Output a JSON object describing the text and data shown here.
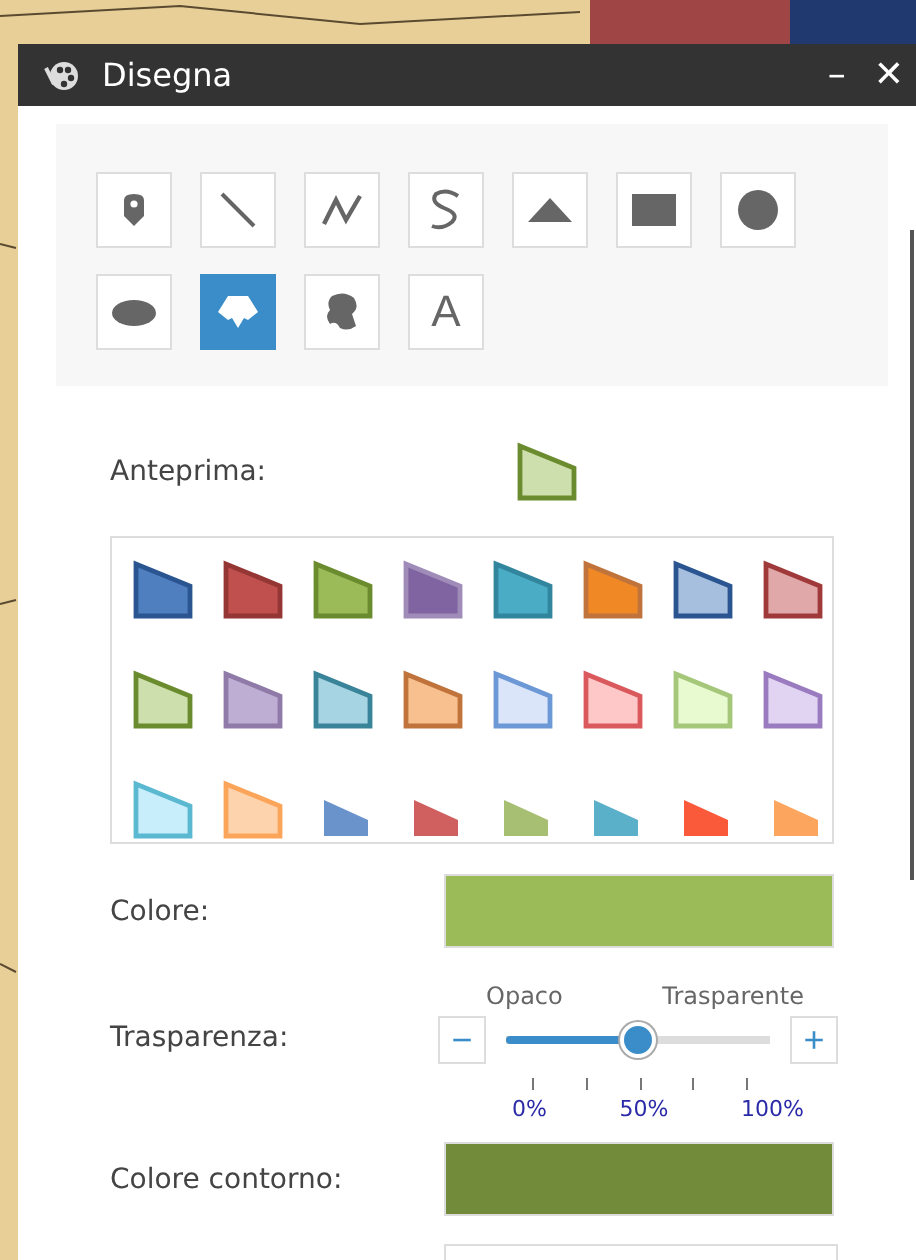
{
  "window": {
    "title": "Disegna",
    "minimize": "–",
    "close": "✕"
  },
  "tools": [
    {
      "kind": "point",
      "selected": false
    },
    {
      "kind": "line",
      "selected": false
    },
    {
      "kind": "polyline",
      "selected": false
    },
    {
      "kind": "freehand-line",
      "selected": false
    },
    {
      "kind": "triangle",
      "selected": false
    },
    {
      "kind": "rectangle",
      "selected": false
    },
    {
      "kind": "circle",
      "selected": false
    },
    {
      "kind": "ellipse",
      "selected": false
    },
    {
      "kind": "polygon",
      "selected": true
    },
    {
      "kind": "freehand-polygon",
      "selected": false
    },
    {
      "kind": "text",
      "label": "A",
      "selected": false
    }
  ],
  "preview": {
    "label": "Anteprima:",
    "fill": {
      "color": "#cddfac"
    },
    "outline": {
      "color": "#6b8c2e"
    }
  },
  "swatches": [
    {
      "kind": "outlined",
      "fill": {
        "color": "#4f7fbf"
      },
      "outline": {
        "color": "#2a5590"
      }
    },
    {
      "kind": "outlined",
      "fill": {
        "color": "#c0504d"
      },
      "outline": {
        "color": "#943634"
      }
    },
    {
      "kind": "outlined",
      "fill": {
        "color": "#9bbb59"
      },
      "outline": {
        "color": "#6b8c2e"
      }
    },
    {
      "kind": "outlined",
      "fill": {
        "color": "#8064a2"
      },
      "outline": {
        "color": "#9f8cb8"
      }
    },
    {
      "kind": "outlined",
      "fill": {
        "color": "#4bacc6"
      },
      "outline": {
        "color": "#31859c"
      }
    },
    {
      "kind": "outlined",
      "fill": {
        "color": "#f08826"
      },
      "outline": {
        "color": "#c0743c"
      }
    },
    {
      "kind": "outlined",
      "fill": {
        "color": "#a7bfde"
      },
      "outline": {
        "color": "#2a5590"
      }
    },
    {
      "kind": "outlined",
      "fill": {
        "color": "#e0a8a8"
      },
      "outline": {
        "color": "#a0393a"
      }
    },
    {
      "kind": "outlined",
      "fill": {
        "color": "#cddfac"
      },
      "outline": {
        "color": "#6b8c2e"
      }
    },
    {
      "kind": "outlined",
      "fill": {
        "color": "#beaed4"
      },
      "outline": {
        "color": "#8f7aa8"
      }
    },
    {
      "kind": "outlined",
      "fill": {
        "color": "#a6d4e2"
      },
      "outline": {
        "color": "#3a8499"
      }
    },
    {
      "kind": "outlined",
      "fill": {
        "color": "#f7c08e"
      },
      "outline": {
        "color": "#c0743c"
      }
    },
    {
      "kind": "outlined",
      "fill": {
        "color": "#dbe5fa"
      },
      "outline": {
        "color": "#6c98d6"
      }
    },
    {
      "kind": "outlined",
      "fill": {
        "color": "#ffc8c8"
      },
      "outline": {
        "color": "#d9595c"
      }
    },
    {
      "kind": "outlined",
      "fill": {
        "color": "#e8fbd0"
      },
      "outline": {
        "color": "#a5c77a"
      }
    },
    {
      "kind": "outlined",
      "fill": {
        "color": "#e0d4f2"
      },
      "outline": {
        "color": "#9b7bc0"
      }
    },
    {
      "kind": "outlined",
      "fill": {
        "color": "#c8eefc"
      },
      "outline": {
        "color": "#5ab8d0"
      }
    },
    {
      "kind": "outlined",
      "fill": {
        "color": "#fdd3ae"
      },
      "outline": {
        "color": "#fba55a"
      }
    },
    {
      "kind": "plain",
      "fill": {
        "color": "#6a93cb"
      }
    },
    {
      "kind": "plain",
      "fill": {
        "color": "#d06060"
      }
    },
    {
      "kind": "plain",
      "fill": {
        "color": "#a6bf72"
      }
    },
    {
      "kind": "plain",
      "fill": {
        "color": "#5ab0c8"
      }
    },
    {
      "kind": "plain",
      "fill": {
        "color": "#fb5a3a"
      }
    },
    {
      "kind": "plain",
      "fill": {
        "color": "#fca55e"
      }
    }
  ],
  "fill": {
    "label": "Colore:",
    "color": "#9bbb59"
  },
  "transparency": {
    "label": "Trasparenza:",
    "left_caption": "Opaco",
    "right_caption": "Trasparente",
    "minus": "−",
    "plus": "+",
    "level": 0.5,
    "ticks": [
      "0%",
      "50%",
      "100%"
    ]
  },
  "outline": {
    "label": "Colore contorno:",
    "color": "#718b3a"
  }
}
